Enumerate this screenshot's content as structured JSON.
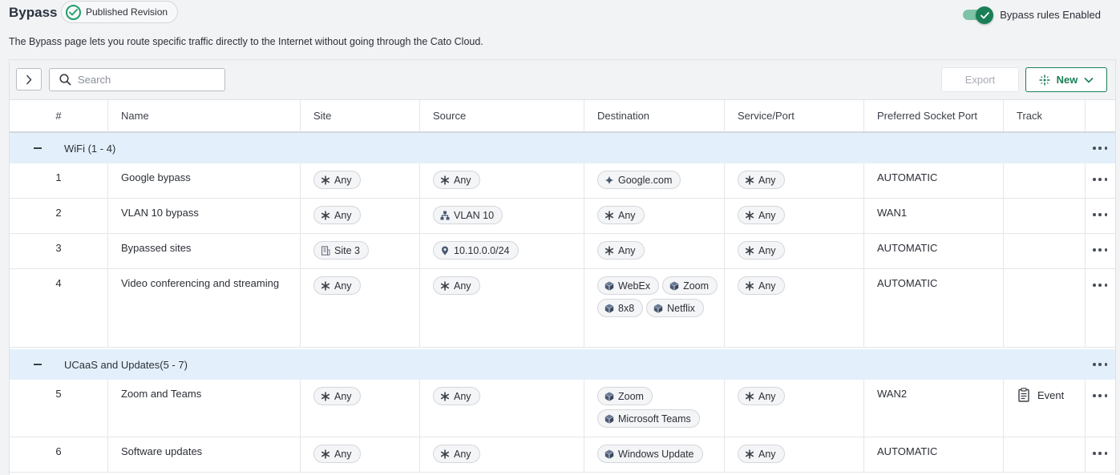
{
  "header": {
    "title": "Bypass",
    "revision_badge": "Published Revision",
    "toggle_label": "Bypass rules Enabled",
    "description": "The Bypass page lets you route specific traffic directly to the Internet without going through the Cato Cloud."
  },
  "toolbar": {
    "search_placeholder": "Search",
    "export_label": "Export",
    "new_label": "New"
  },
  "columns": [
    "#",
    "Name",
    "Site",
    "Source",
    "Destination",
    "Service/Port",
    "Preferred Socket Port",
    "Track"
  ],
  "groups": [
    {
      "label": "WiFi (1 - 4)",
      "rows": [
        {
          "num": "1",
          "name": "Google bypass",
          "site": [
            {
              "icon": "asterisk",
              "label": "Any"
            }
          ],
          "source": [
            {
              "icon": "asterisk",
              "label": "Any"
            }
          ],
          "destination": [
            {
              "icon": "sparkle",
              "label": "Google.com"
            }
          ],
          "service": [
            {
              "icon": "asterisk",
              "label": "Any"
            }
          ],
          "port": "AUTOMATIC",
          "track": ""
        },
        {
          "num": "2",
          "name": "VLAN 10 bypass",
          "site": [
            {
              "icon": "asterisk",
              "label": "Any"
            }
          ],
          "source": [
            {
              "icon": "network",
              "label": "VLAN 10"
            }
          ],
          "destination": [
            {
              "icon": "asterisk",
              "label": "Any"
            }
          ],
          "service": [
            {
              "icon": "asterisk",
              "label": "Any"
            }
          ],
          "port": "WAN1",
          "track": ""
        },
        {
          "num": "3",
          "name": "Bypassed sites",
          "site": [
            {
              "icon": "building",
              "label": "Site 3"
            }
          ],
          "source": [
            {
              "icon": "pin",
              "label": "10.10.0.0/24"
            }
          ],
          "destination": [
            {
              "icon": "asterisk",
              "label": "Any"
            }
          ],
          "service": [
            {
              "icon": "asterisk",
              "label": "Any"
            }
          ],
          "port": "AUTOMATIC",
          "track": ""
        },
        {
          "num": "4",
          "name": "Video conferencing and streaming",
          "site": [
            {
              "icon": "asterisk",
              "label": "Any"
            }
          ],
          "source": [
            {
              "icon": "asterisk",
              "label": "Any"
            }
          ],
          "destination": [
            {
              "icon": "cube",
              "label": "WebEx"
            },
            {
              "icon": "cube",
              "label": "Zoom"
            },
            {
              "icon": "cube",
              "label": "8x8"
            },
            {
              "icon": "cube",
              "label": "Netflix"
            }
          ],
          "service": [
            {
              "icon": "asterisk",
              "label": "Any"
            }
          ],
          "port": "AUTOMATIC",
          "track": ""
        }
      ]
    },
    {
      "label": "UCaaS and Updates(5 - 7)",
      "rows": [
        {
          "num": "5",
          "name": "Zoom and Teams",
          "site": [
            {
              "icon": "asterisk",
              "label": "Any"
            }
          ],
          "source": [
            {
              "icon": "asterisk",
              "label": "Any"
            }
          ],
          "destination": [
            {
              "icon": "cube",
              "label": "Zoom"
            },
            {
              "icon": "cube",
              "label": "Microsoft Teams"
            }
          ],
          "service": [
            {
              "icon": "asterisk",
              "label": "Any"
            }
          ],
          "port": "WAN2",
          "track": "Event"
        },
        {
          "num": "6",
          "name": "Software updates",
          "site": [
            {
              "icon": "asterisk",
              "label": "Any"
            }
          ],
          "source": [
            {
              "icon": "asterisk",
              "label": "Any"
            }
          ],
          "destination": [
            {
              "icon": "cube",
              "label": "Windows Update"
            }
          ],
          "service": [
            {
              "icon": "asterisk",
              "label": "Any"
            }
          ],
          "port": "AUTOMATIC",
          "track": ""
        }
      ]
    }
  ],
  "colors": {
    "accent": "#1a7f56",
    "group_bg": "#e3f0fb"
  }
}
